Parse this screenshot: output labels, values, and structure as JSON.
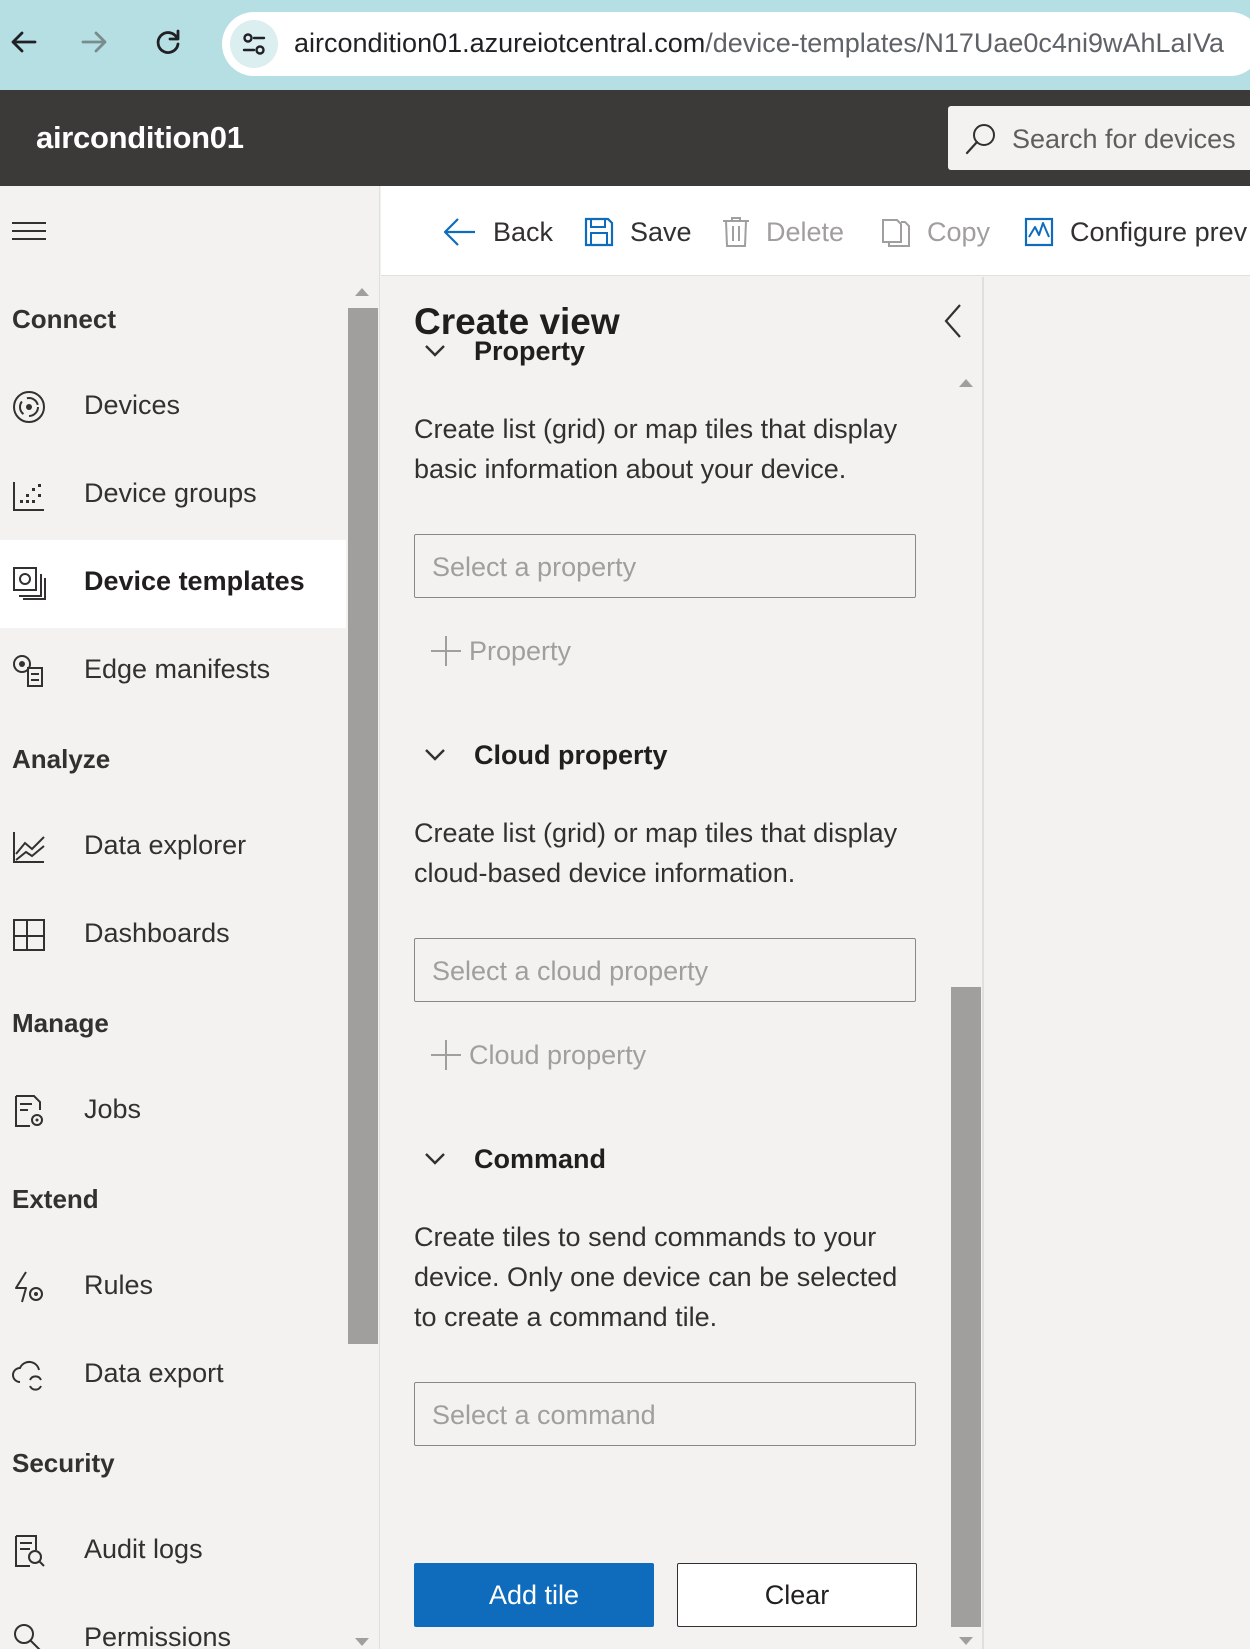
{
  "browser": {
    "url_host": "aircondition01.azureiotcentral.com",
    "url_path": "/device-templates/N17Uae0c4ni9wAhLaIVa"
  },
  "app": {
    "title": "aircondition01",
    "search_placeholder": "Search for devices"
  },
  "sidebar": {
    "sections": {
      "connect": "Connect",
      "analyze": "Analyze",
      "manage": "Manage",
      "extend": "Extend",
      "security": "Security"
    },
    "items": [
      {
        "label": "Devices",
        "icon": "devices-icon"
      },
      {
        "label": "Device groups",
        "icon": "device-groups-icon"
      },
      {
        "label": "Device templates",
        "icon": "device-templates-icon",
        "active": true
      },
      {
        "label": "Edge manifests",
        "icon": "edge-manifests-icon"
      },
      {
        "label": "Data explorer",
        "icon": "data-explorer-icon"
      },
      {
        "label": "Dashboards",
        "icon": "dashboards-icon"
      },
      {
        "label": "Jobs",
        "icon": "jobs-icon"
      },
      {
        "label": "Rules",
        "icon": "rules-icon"
      },
      {
        "label": "Data export",
        "icon": "data-export-icon"
      },
      {
        "label": "Audit logs",
        "icon": "audit-logs-icon"
      },
      {
        "label": "Permissions",
        "icon": "permissions-icon"
      }
    ]
  },
  "toolbar": {
    "back": "Back",
    "save": "Save",
    "delete": "Delete",
    "copy": "Copy",
    "configure": "Configure prev"
  },
  "panel": {
    "title": "Create view",
    "property": {
      "heading": "Property",
      "description": "Create list (grid) or map tiles that display basic information about your device.",
      "placeholder": "Select a property",
      "add_label": "Property"
    },
    "cloud_property": {
      "heading": "Cloud property",
      "description": "Create list (grid) or map tiles that display cloud-based device information.",
      "placeholder": "Select a cloud property",
      "add_label": "Cloud property"
    },
    "command": {
      "heading": "Command",
      "description": "Create tiles to send commands to your device. Only one device can be selected to create a command tile.",
      "placeholder": "Select a command"
    },
    "add_tile": "Add tile",
    "clear": "Clear"
  },
  "colors": {
    "browser_bar": "#b6dfe4",
    "app_header": "#3b3a39",
    "primary": "#0f6cbd"
  }
}
